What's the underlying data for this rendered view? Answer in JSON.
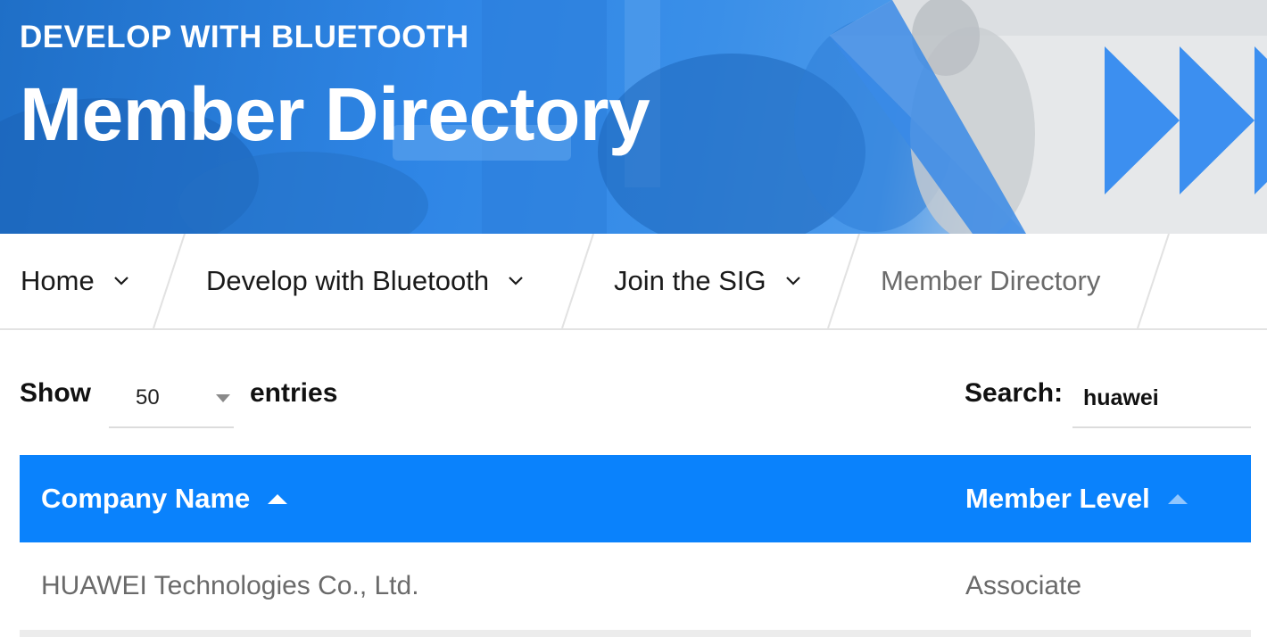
{
  "hero": {
    "kicker": "DEVELOP WITH BLUETOOTH",
    "title": "Member Directory"
  },
  "breadcrumb": [
    {
      "label": "Home",
      "has_menu": true
    },
    {
      "label": "Develop with Bluetooth",
      "has_menu": true
    },
    {
      "label": "Join the SIG",
      "has_menu": true
    },
    {
      "label": "Member Directory",
      "has_menu": false,
      "current": true
    }
  ],
  "controls": {
    "show_label": "Show",
    "page_size": "50",
    "entries_label": "entries",
    "search_label": "Search:",
    "search_value": "huawei"
  },
  "table": {
    "columns": [
      "Company Name",
      "Member Level"
    ],
    "rows": [
      [
        "HUAWEI Technologies Co., Ltd.",
        "Associate"
      ]
    ]
  },
  "colors": {
    "brand_blue": "#0a82fc",
    "hero_blue": "#2f86e6",
    "chevron_blue": "#3c8ff0"
  },
  "icons": {
    "dropdown": "chevron-down-icon",
    "select_caret": "caret-down-icon",
    "sort": "sort-ascending-icon",
    "hero_arrows": "fast-forward-arrows-icon"
  }
}
